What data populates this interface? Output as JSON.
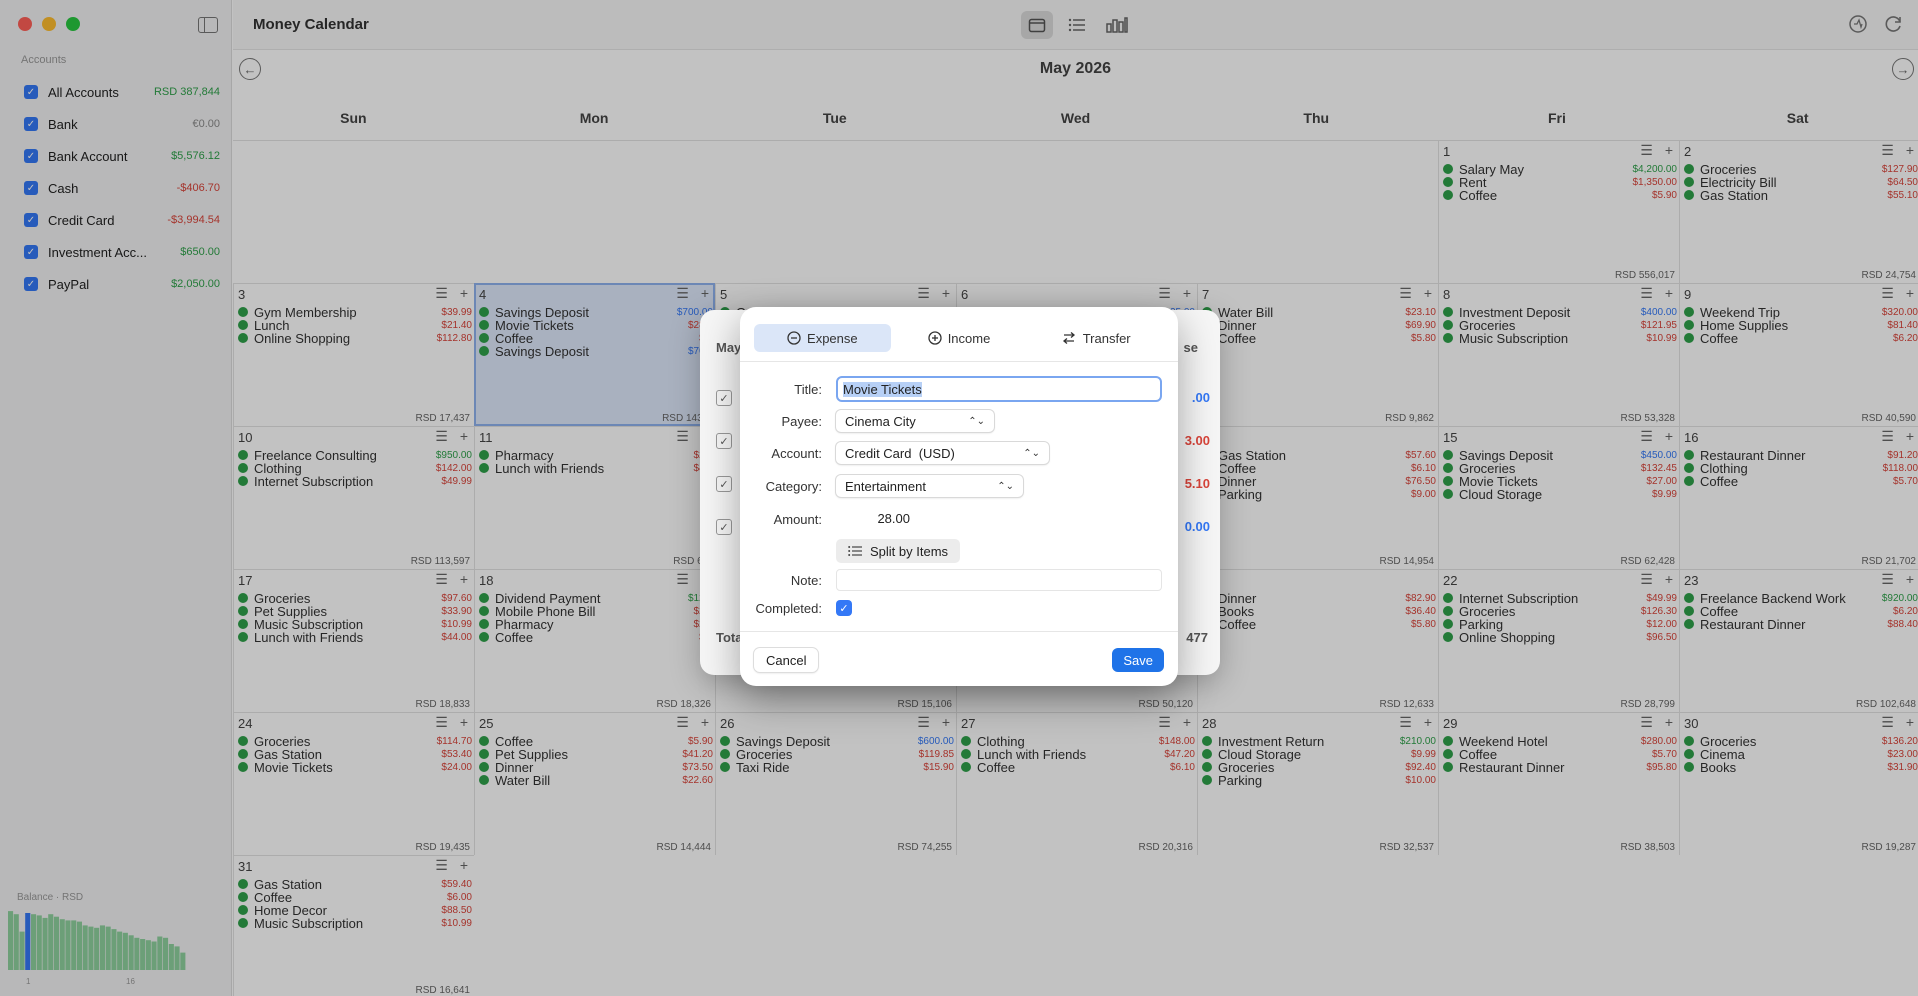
{
  "app": {
    "title": "Money Calendar"
  },
  "sidebar": {
    "accounts_header": "Accounts",
    "accounts": [
      {
        "name": "All Accounts",
        "value": "RSD 387,844",
        "tone": "pos"
      },
      {
        "name": "Bank",
        "value": "€0.00",
        "tone": "gray"
      },
      {
        "name": "Bank Account",
        "value": "$5,576.12",
        "tone": "pos"
      },
      {
        "name": "Cash",
        "value": "-$406.70",
        "tone": "neg"
      },
      {
        "name": "Credit Card",
        "value": "-$3,994.54",
        "tone": "neg"
      },
      {
        "name": "Investment Acc...",
        "value": "$650.00",
        "tone": "pos"
      },
      {
        "name": "PayPal",
        "value": "$2,050.00",
        "tone": "pos"
      }
    ],
    "balance": {
      "label": "Balance · RSD",
      "tick_start": "1",
      "tick_mid": "16",
      "bars": [
        0.95,
        0.9,
        0.62,
        0.92,
        0.9,
        0.88,
        0.84,
        0.9,
        0.86,
        0.82,
        0.8,
        0.8,
        0.78,
        0.72,
        0.7,
        0.68,
        0.72,
        0.7,
        0.66,
        0.62,
        0.6,
        0.56,
        0.52,
        0.5,
        0.48,
        0.46,
        0.54,
        0.52,
        0.42,
        0.38,
        0.28
      ],
      "selected_index": 3
    }
  },
  "header": {
    "views": [
      "calendar-icon",
      "list-icon",
      "bar-chart-icon"
    ],
    "month": "May 2026",
    "weekdays": [
      "Sun",
      "Mon",
      "Tue",
      "Wed",
      "Thu",
      "Fri",
      "Sat"
    ]
  },
  "weeks": [
    [
      null,
      null,
      null,
      null,
      null,
      {
        "day": "1",
        "total": "RSD 556,017",
        "tx": [
          [
            "Salary May",
            "$4,200.00",
            "pos"
          ],
          [
            "Rent",
            "$1,350.00",
            "neg"
          ],
          [
            "Coffee",
            "$5.90",
            "neg"
          ]
        ]
      },
      {
        "day": "2",
        "total": "RSD 24,754",
        "tx": [
          [
            "Groceries",
            "$127.90",
            "neg"
          ],
          [
            "Electricity Bill",
            "$64.50",
            "neg"
          ],
          [
            "Gas Station",
            "$55.10",
            "neg"
          ]
        ]
      }
    ],
    [
      {
        "day": "3",
        "total": "RSD 17,437",
        "tx": [
          [
            "Gym Membership",
            "$39.99",
            "neg"
          ],
          [
            "Lunch",
            "$21.40",
            "neg"
          ],
          [
            "Online Shopping",
            "$112.80",
            "neg"
          ]
        ]
      },
      {
        "day": "4",
        "total": "RSD 143,5",
        "sel": true,
        "tx": [
          [
            "Savings Deposit",
            "$700.00",
            "blue"
          ],
          [
            "Movie Tickets",
            "$28.0",
            "neg"
          ],
          [
            "Coffee",
            "$6.",
            "neg"
          ],
          [
            "Savings Deposit",
            "$700.",
            "blue"
          ]
        ]
      },
      {
        "day": "5",
        "total": "",
        "tx": [
          [
            "Gr",
            "",
            "neg"
          ]
        ]
      },
      {
        "day": "6",
        "total": "",
        "tx": [
          [
            "",
            "35.00",
            "blue"
          ]
        ]
      },
      {
        "day": "7",
        "total": "RSD 9,862",
        "tx": [
          [
            "Water Bill",
            "$23.10",
            "neg"
          ],
          [
            "Dinner",
            "$69.90",
            "neg"
          ],
          [
            "Coffee",
            "$5.80",
            "neg"
          ]
        ]
      },
      {
        "day": "8",
        "total": "RSD 53,328",
        "tx": [
          [
            "Investment Deposit",
            "$400.00",
            "blue"
          ],
          [
            "Groceries",
            "$121.95",
            "neg"
          ],
          [
            "Music Subscription",
            "$10.99",
            "neg"
          ]
        ]
      },
      {
        "day": "9",
        "total": "RSD 40,590",
        "tx": [
          [
            "Weekend Trip",
            "$320.00",
            "neg"
          ],
          [
            "Home Supplies",
            "$81.40",
            "neg"
          ],
          [
            "Coffee",
            "$6.20",
            "neg"
          ]
        ]
      }
    ],
    [
      {
        "day": "10",
        "total": "RSD 113,597",
        "tx": [
          [
            "Freelance Consulting",
            "$950.00",
            "pos"
          ],
          [
            "Clothing",
            "$142.00",
            "neg"
          ],
          [
            "Internet Subscription",
            "$49.99",
            "neg"
          ]
        ]
      },
      {
        "day": "11",
        "total": "RSD 6,8",
        "tx": [
          [
            "Pharmacy",
            "$22.",
            "neg"
          ],
          [
            "Lunch with Friends",
            "$46.",
            "neg"
          ]
        ]
      },
      {
        "day": "",
        "total": "",
        "tx": []
      },
      {
        "day": "",
        "total": "",
        "tx": []
      },
      {
        "day": "",
        "total": "RSD 14,954",
        "tx": [
          [
            "Gas Station",
            "$57.60",
            "neg"
          ],
          [
            "Coffee",
            "$6.10",
            "neg"
          ],
          [
            "Dinner",
            "$76.50",
            "neg"
          ],
          [
            "Parking",
            "$9.00",
            "neg"
          ]
        ]
      },
      {
        "day": "15",
        "total": "RSD 62,428",
        "tx": [
          [
            "Savings Deposit",
            "$450.00",
            "blue"
          ],
          [
            "Groceries",
            "$132.45",
            "neg"
          ],
          [
            "Movie Tickets",
            "$27.00",
            "neg"
          ],
          [
            "Cloud Storage",
            "$9.99",
            "neg"
          ]
        ]
      },
      {
        "day": "16",
        "total": "RSD 21,702",
        "tx": [
          [
            "Restaurant Dinner",
            "$91.20",
            "neg"
          ],
          [
            "Clothing",
            "$118.00",
            "neg"
          ],
          [
            "Coffee",
            "$5.70",
            "neg"
          ]
        ]
      }
    ],
    [
      {
        "day": "17",
        "total": "RSD 18,833",
        "tx": [
          [
            "Groceries",
            "$97.60",
            "neg"
          ],
          [
            "Pet Supplies",
            "$33.90",
            "neg"
          ],
          [
            "Music Subscription",
            "$10.99",
            "neg"
          ],
          [
            "Lunch with Friends",
            "$44.00",
            "neg"
          ]
        ]
      },
      {
        "day": "18",
        "total": "RSD 18,326",
        "tx": [
          [
            "Dividend Payment",
            "$122.",
            "pos"
          ],
          [
            "Mobile Phone Bill",
            "$29.",
            "neg"
          ],
          [
            "Pharmacy",
            "$24.",
            "neg"
          ],
          [
            "Coffee",
            "$6.",
            "neg"
          ]
        ]
      },
      {
        "day": "",
        "total": "RSD 15,106",
        "tx": []
      },
      {
        "day": "",
        "total": "RSD 50,120",
        "tx": []
      },
      {
        "day": "",
        "total": "RSD 12,633",
        "tx": [
          [
            "Dinner",
            "$82.90",
            "neg"
          ],
          [
            "Books",
            "$36.40",
            "neg"
          ],
          [
            "Coffee",
            "$5.80",
            "neg"
          ]
        ]
      },
      {
        "day": "22",
        "total": "RSD 28,799",
        "tx": [
          [
            "Internet Subscription",
            "$49.99",
            "neg"
          ],
          [
            "Groceries",
            "$126.30",
            "neg"
          ],
          [
            "Parking",
            "$12.00",
            "neg"
          ],
          [
            "Online Shopping",
            "$96.50",
            "neg"
          ]
        ]
      },
      {
        "day": "23",
        "total": "RSD 102,648",
        "tx": [
          [
            "Freelance Backend Work",
            "$920.00",
            "pos"
          ],
          [
            "Coffee",
            "$6.20",
            "neg"
          ],
          [
            "Restaurant Dinner",
            "$88.40",
            "neg"
          ]
        ]
      }
    ],
    [
      {
        "day": "24",
        "total": "RSD 19,435",
        "tx": [
          [
            "Groceries",
            "$114.70",
            "neg"
          ],
          [
            "Gas Station",
            "$53.40",
            "neg"
          ],
          [
            "Movie Tickets",
            "$24.00",
            "neg"
          ]
        ]
      },
      {
        "day": "25",
        "total": "RSD 14,444",
        "tx": [
          [
            "Coffee",
            "$5.90",
            "neg"
          ],
          [
            "Pet Supplies",
            "$41.20",
            "neg"
          ],
          [
            "Dinner",
            "$73.50",
            "neg"
          ],
          [
            "Water Bill",
            "$22.60",
            "neg"
          ]
        ]
      },
      {
        "day": "26",
        "total": "RSD 74,255",
        "tx": [
          [
            "Savings Deposit",
            "$600.00",
            "blue"
          ],
          [
            "Groceries",
            "$119.85",
            "neg"
          ],
          [
            "Taxi Ride",
            "$15.90",
            "neg"
          ]
        ]
      },
      {
        "day": "27",
        "total": "RSD 20,316",
        "tx": [
          [
            "Clothing",
            "$148.00",
            "neg"
          ],
          [
            "Lunch with Friends",
            "$47.20",
            "neg"
          ],
          [
            "Coffee",
            "$6.10",
            "neg"
          ]
        ]
      },
      {
        "day": "28",
        "total": "RSD 32,537",
        "tx": [
          [
            "Investment Return",
            "$210.00",
            "pos"
          ],
          [
            "Cloud Storage",
            "$9.99",
            "neg"
          ],
          [
            "Groceries",
            "$92.40",
            "neg"
          ],
          [
            "Parking",
            "$10.00",
            "neg"
          ]
        ]
      },
      {
        "day": "29",
        "total": "RSD 38,503",
        "tx": [
          [
            "Weekend Hotel",
            "$280.00",
            "neg"
          ],
          [
            "Coffee",
            "$5.70",
            "neg"
          ],
          [
            "Restaurant Dinner",
            "$95.80",
            "neg"
          ]
        ]
      },
      {
        "day": "30",
        "total": "RSD 19,287",
        "tx": [
          [
            "Groceries",
            "$136.20",
            "neg"
          ],
          [
            "Cinema",
            "$23.00",
            "neg"
          ],
          [
            "Books",
            "$31.90",
            "neg"
          ]
        ]
      }
    ],
    [
      {
        "day": "31",
        "total": "RSD 16,641",
        "tx": [
          [
            "Gas Station",
            "$59.40",
            "neg"
          ],
          [
            "Coffee",
            "$6.00",
            "neg"
          ],
          [
            "Home Decor",
            "$88.50",
            "neg"
          ],
          [
            "Music Subscription",
            "$10.99",
            "neg"
          ]
        ]
      }
    ]
  ],
  "backsheet": {
    "may": "May",
    "se": "se",
    "total_label": "Tota",
    "total_value": "477",
    "amounts": [
      ".00",
      "3.00",
      "5.10",
      "0.00"
    ]
  },
  "dialog": {
    "tabs": [
      {
        "label": "Expense",
        "icon": "minus-circle-icon"
      },
      {
        "label": "Income",
        "icon": "plus-circle-icon"
      },
      {
        "label": "Transfer",
        "icon": "transfer-arrows-icon"
      }
    ],
    "title_label": "Title:",
    "title_value": "Movie Tickets",
    "payee_label": "Payee:",
    "payee_value": "Cinema City",
    "account_label": "Account:",
    "account_value": "Credit Card  (USD)",
    "category_label": "Category:",
    "category_value": "Entertainment",
    "amount_label": "Amount:",
    "amount_value": "28.00",
    "split_label": "Split by Items",
    "note_label": "Note:",
    "note_value": "",
    "completed_label": "Completed:",
    "cancel": "Cancel",
    "save": "Save"
  }
}
